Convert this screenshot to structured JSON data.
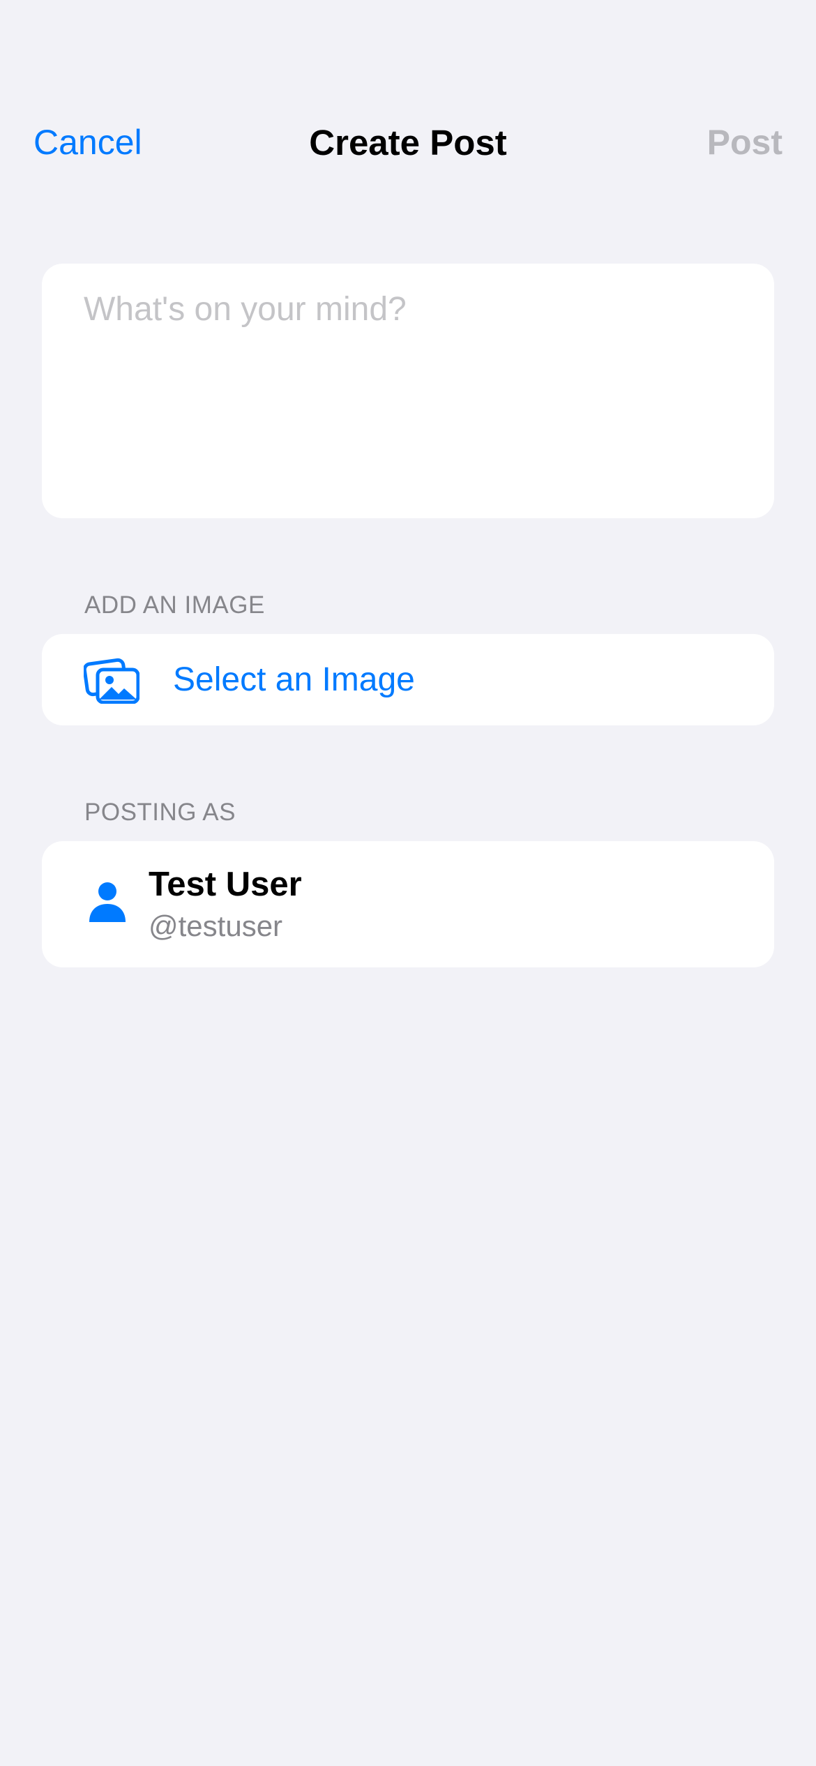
{
  "nav": {
    "cancel_label": "Cancel",
    "title": "Create Post",
    "post_label": "Post"
  },
  "composer": {
    "placeholder": "What's on your mind?",
    "value": ""
  },
  "image_section": {
    "header": "ADD AN IMAGE",
    "select_label": "Select an Image",
    "icon": "photo-stack-icon"
  },
  "posting_as": {
    "header": "POSTING AS",
    "name": "Test User",
    "handle": "@testuser",
    "icon": "person-icon"
  },
  "colors": {
    "accent": "#007aff",
    "background": "#f2f2f7",
    "disabled": "#b8b8bd",
    "secondary_text": "#86868b"
  }
}
